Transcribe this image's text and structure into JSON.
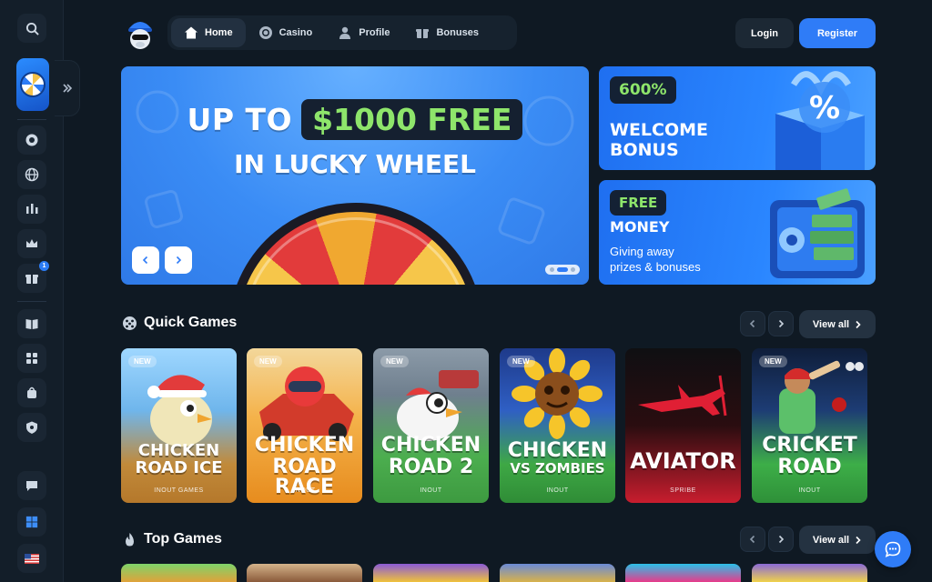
{
  "nav": {
    "items": [
      {
        "label": "Home",
        "icon": "home-icon",
        "active": true
      },
      {
        "label": "Casino",
        "icon": "casino-chip-icon",
        "active": false
      },
      {
        "label": "Profile",
        "icon": "user-icon",
        "active": false
      },
      {
        "label": "Bonuses",
        "icon": "gift-icon",
        "active": false
      }
    ],
    "login_label": "Login",
    "register_label": "Register"
  },
  "sidebar": {
    "badge_count": "1",
    "icons": [
      "search-icon",
      "casino-chip-icon",
      "globe-icon",
      "sports-icon",
      "crown-icon",
      "gift-icon",
      "book-icon",
      "puzzle-icon",
      "bag-icon",
      "shield-icon",
      "chat-icon",
      "windows-icon",
      "us-flag-icon"
    ]
  },
  "hero": {
    "line1_prefix": "UP TO",
    "line1_highlight": "$1000 FREE",
    "line2": "IN LUCKY WHEEL"
  },
  "promos": [
    {
      "chip": "600%",
      "title_line1": "WELCOME",
      "title_line2": "BONUS"
    },
    {
      "chip": "FREE",
      "title": "MONEY",
      "sub_line1": "Giving away",
      "sub_line2": "prizes & bonuses"
    }
  ],
  "quick_games": {
    "title": "Quick Games",
    "view_all": "View all",
    "games": [
      {
        "line1": "CHICKEN",
        "line2": "ROAD ICE",
        "provider": "INOUT GAMES",
        "new": true,
        "badge": "NEW"
      },
      {
        "line1": "CHICKEN",
        "line2": "ROAD RACE",
        "provider": "INOUT",
        "new": true,
        "badge": "NEW"
      },
      {
        "line1": "CHICKEN",
        "line2": "ROAD 2",
        "provider": "INOUT",
        "new": true,
        "badge": "NEW"
      },
      {
        "line1": "CHICKEN",
        "line2": "VS ZOMBIES",
        "provider": "INOUT",
        "new": true,
        "badge": "NEW"
      },
      {
        "line1": "AVIATOR",
        "line2": "",
        "provider": "SPRIBE",
        "new": false,
        "badge": ""
      },
      {
        "line1": "CRICKET",
        "line2": "ROAD",
        "provider": "INOUT",
        "new": true,
        "badge": "NEW"
      }
    ]
  },
  "top_games": {
    "title": "Top Games",
    "view_all": "View all"
  },
  "colors": {
    "background": "#0f1923",
    "accent": "#2f7cf7",
    "highlight_green": "#8ee56b"
  }
}
